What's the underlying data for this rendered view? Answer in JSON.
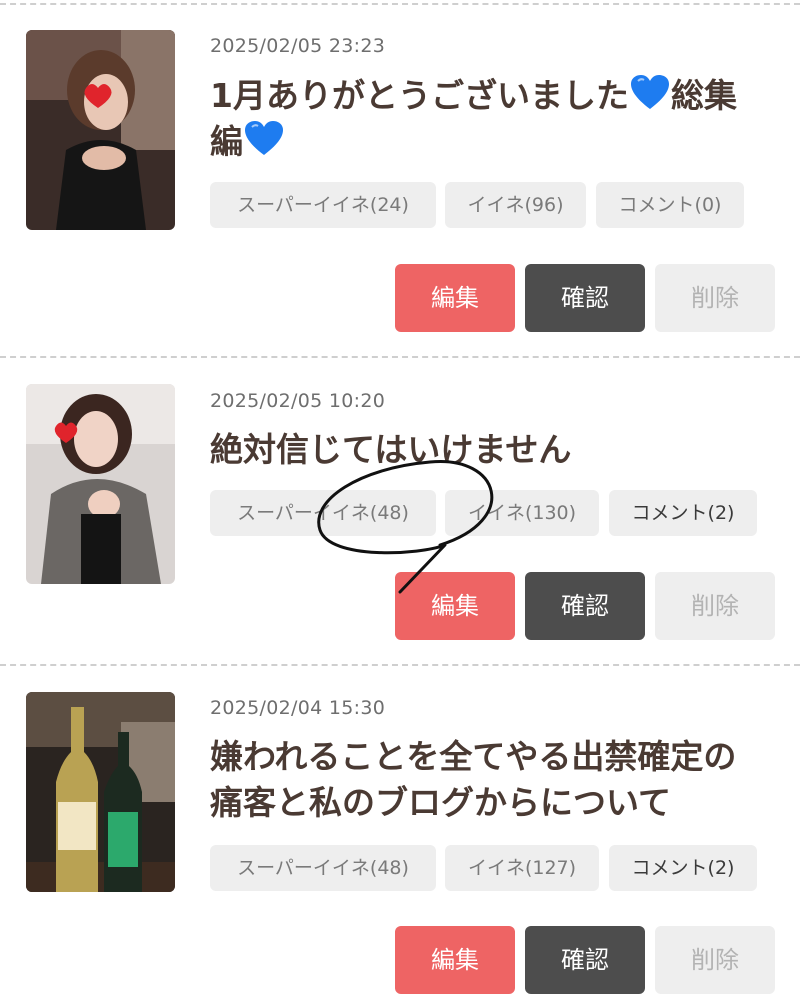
{
  "posts": [
    {
      "timestamp": "2025/02/05 23:23",
      "title_parts": [
        "1月ありがとうございました",
        "総集編"
      ],
      "title_line2": "編",
      "title_icon": "blue-heart-icon",
      "tags": {
        "super_like": "スーパーイイネ(24)",
        "like": "イイネ(96)",
        "comment": "コメント(0)"
      },
      "buttons": {
        "edit": "編集",
        "confirm": "確認",
        "delete": "削除"
      }
    },
    {
      "timestamp": "2025/02/05 10:20",
      "title": "絶対信じてはいけません",
      "tags": {
        "super_like": "スーパーイイネ(48)",
        "like": "イイネ(130)",
        "comment": "コメント(2)"
      },
      "buttons": {
        "edit": "編集",
        "confirm": "確認",
        "delete": "削除"
      }
    },
    {
      "timestamp": "2025/02/04 15:30",
      "title_line1": "嫌われることを全てやる出禁確定の",
      "title_line2": "痛客と私のブログからについて",
      "tags": {
        "super_like": "スーパーイイネ(48)",
        "like": "イイネ(127)",
        "comment": "コメント(2)"
      },
      "buttons": {
        "edit": "編集",
        "confirm": "確認",
        "delete": "削除"
      }
    }
  ],
  "colors": {
    "edit": "#ee6464",
    "confirm": "#4d4d4d",
    "delete_bg": "#eeeeee",
    "title": "#4a3a33",
    "heart": "#1e7cf0"
  }
}
